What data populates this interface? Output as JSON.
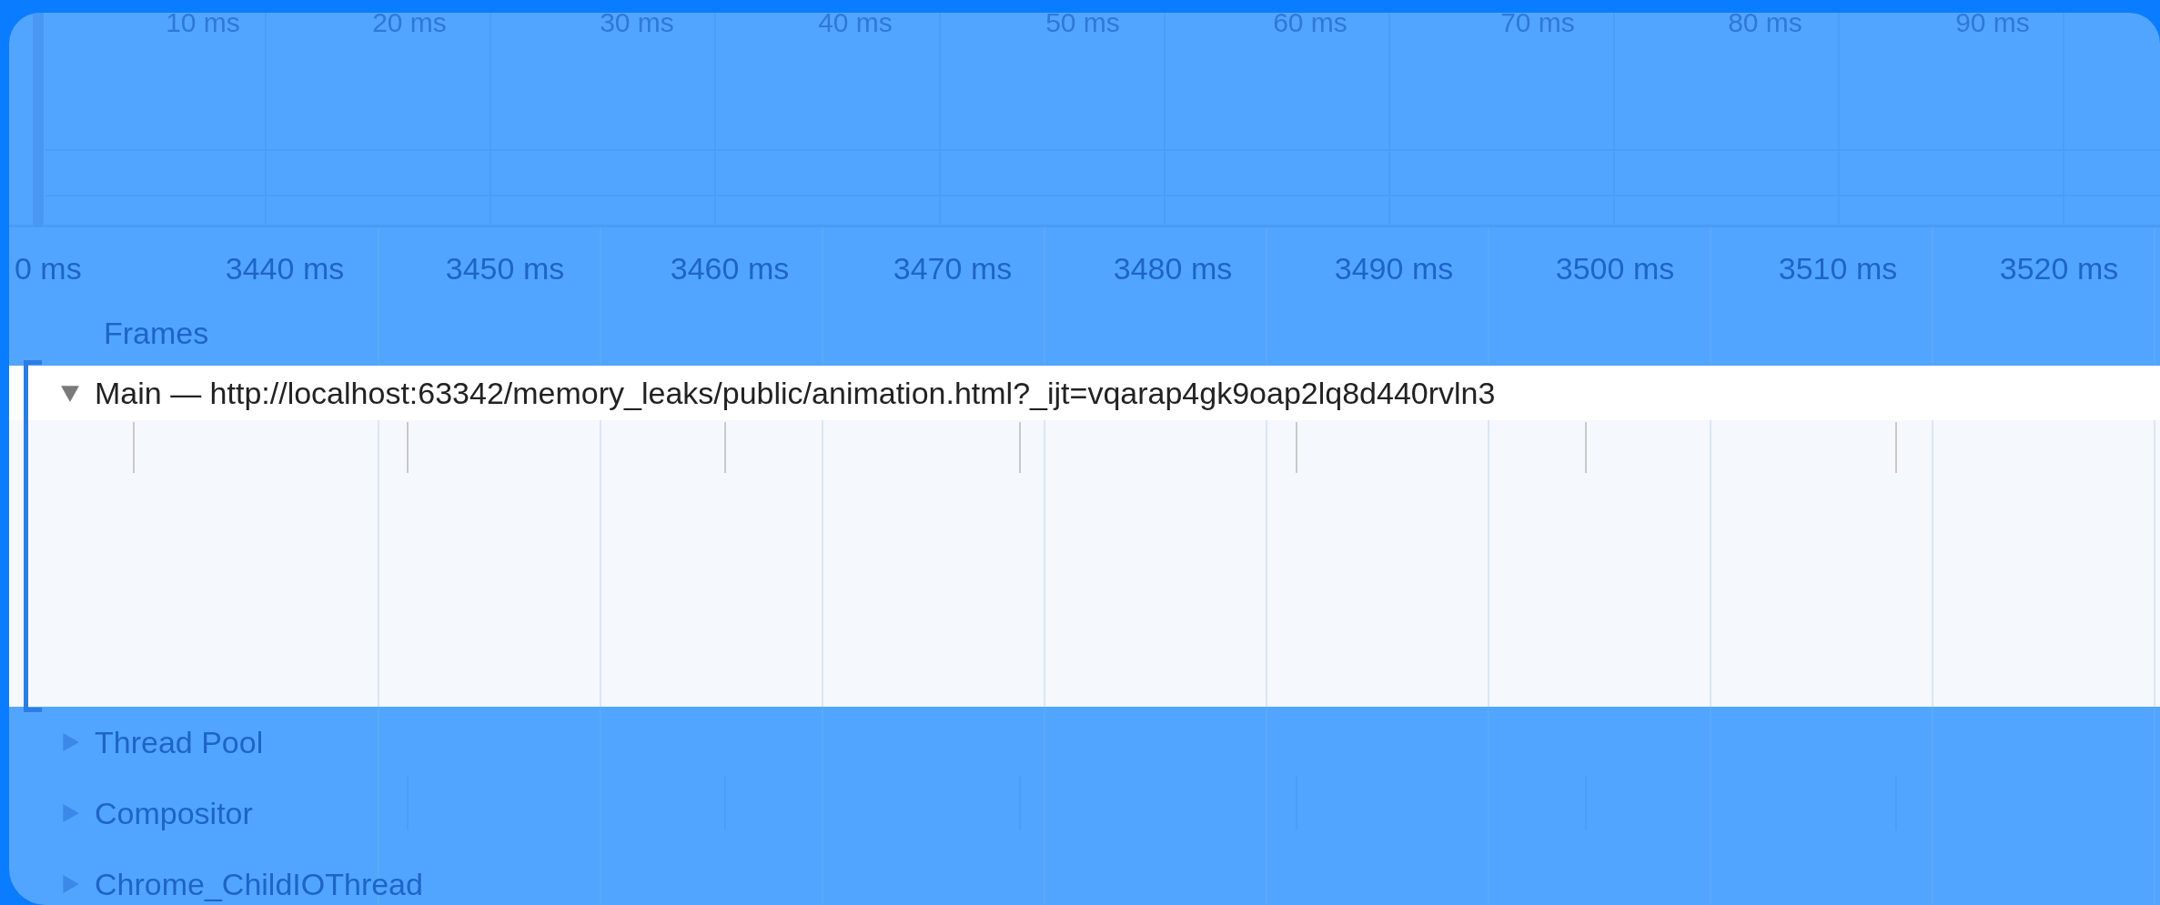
{
  "overview": {
    "ticks": [
      "10 ms",
      "20 ms",
      "30 ms",
      "40 ms",
      "50 ms",
      "60 ms",
      "70 ms",
      "80 ms",
      "90 ms"
    ]
  },
  "ruler": {
    "ticks": [
      "0 ms",
      "3440 ms",
      "3450 ms",
      "3460 ms",
      "3470 ms",
      "3480 ms",
      "3490 ms",
      "3500 ms",
      "3510 ms",
      "3520 ms"
    ]
  },
  "tracks": [
    {
      "kind": "label",
      "label": "Frames",
      "selected": false
    },
    {
      "kind": "group",
      "label": "Main — http://localhost:63342/memory_leaks/public/animation.html?_ijt=vqarap4gk9oap2lq8d440rvln3",
      "expanded": true,
      "selected": true
    },
    {
      "kind": "group",
      "label": "Thread Pool",
      "expanded": false,
      "selected": false
    },
    {
      "kind": "group",
      "label": "Compositor",
      "expanded": false,
      "selected": false
    },
    {
      "kind": "group",
      "label": "Chrome_ChildIOThread",
      "expanded": false,
      "selected": false
    }
  ]
}
